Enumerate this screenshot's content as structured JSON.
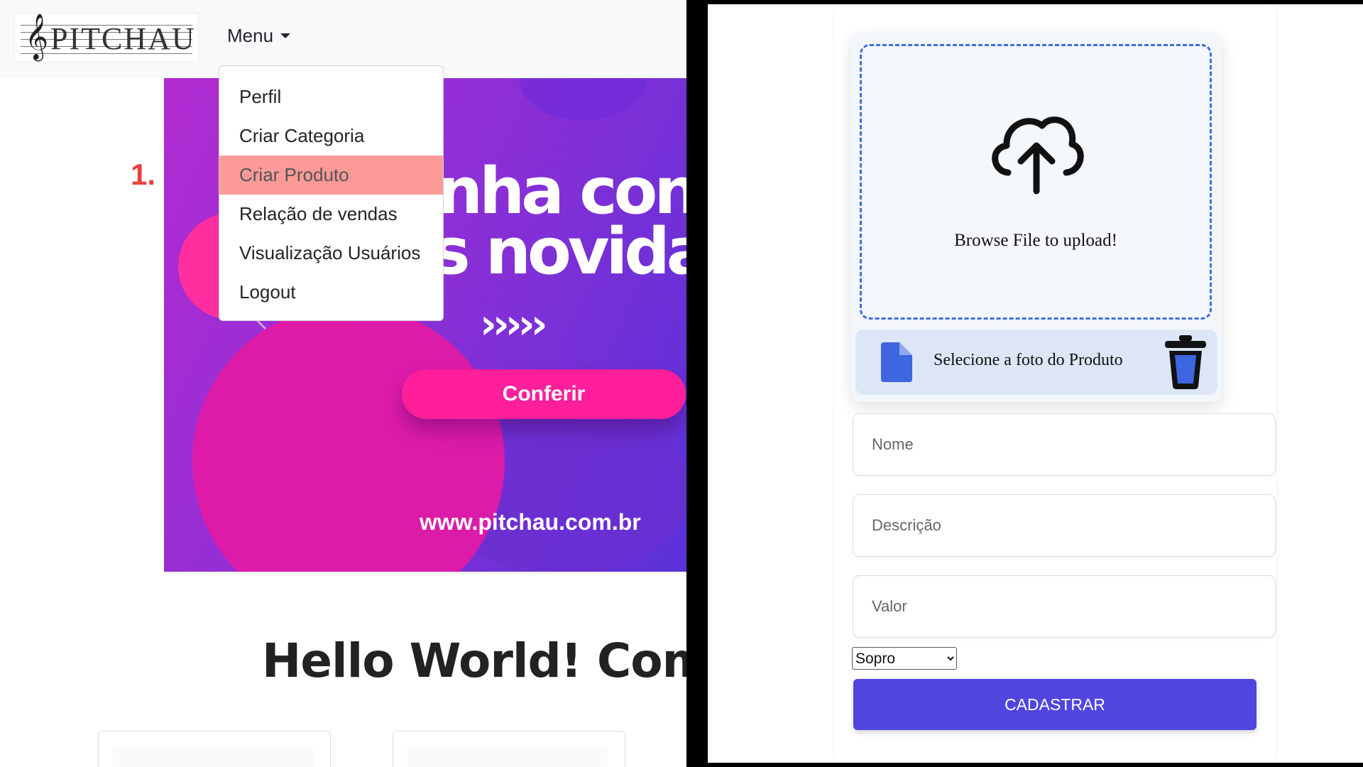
{
  "left": {
    "logo": {
      "text": "PITCHAU",
      "clef": "𝄞"
    },
    "menu": {
      "label": "Menu",
      "items": [
        {
          "label": "Perfil"
        },
        {
          "label": "Criar Categoria"
        },
        {
          "label": "Criar Produto",
          "active": true
        },
        {
          "label": "Relação de vendas"
        },
        {
          "label": "Visualização Usuários"
        },
        {
          "label": "Logout"
        }
      ]
    },
    "step_marker": "1.",
    "banner": {
      "line1": "nha confe",
      "line2": "s novida",
      "chevrons": "›››››",
      "button": "Conferir",
      "url": "www.pitchau.com.br"
    },
    "heading": "Hello World! Comp"
  },
  "right": {
    "upload": {
      "browse_text": "Browse File to upload!",
      "file_text": "Selecione a foto do Produto"
    },
    "fields": {
      "nome_placeholder": "Nome",
      "descricao_placeholder": "Descrição",
      "valor_placeholder": "Valor"
    },
    "category_select": {
      "selected": "Sopro"
    },
    "submit_label": "CADASTRAR"
  },
  "colors": {
    "menu_active_bg": "#fc9a98",
    "step_marker": "#e8403a",
    "submit_bg": "#4f46e0",
    "dropzone_border": "#3f6fe0",
    "banner_button": "#ff1f9a"
  },
  "icons": {
    "upload": "cloud-upload-icon",
    "file": "file-icon",
    "trash": "trash-icon",
    "menu_caret": "caret-down-icon",
    "carousel_prev": "chevron-left-icon"
  }
}
